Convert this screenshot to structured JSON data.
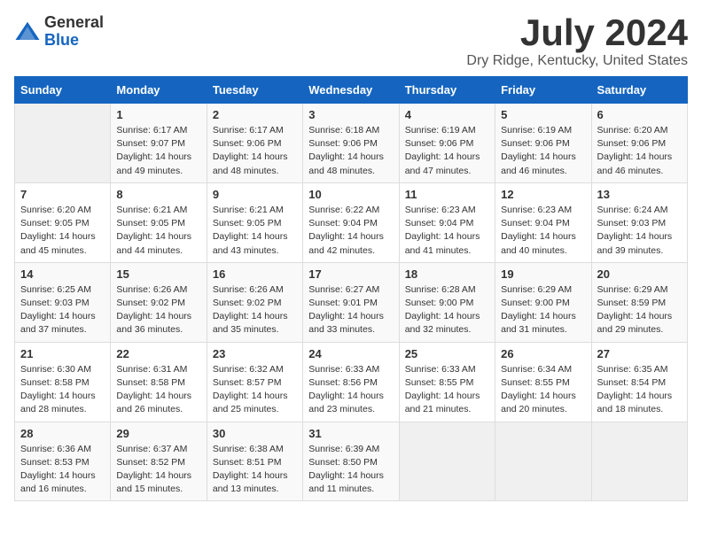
{
  "logo": {
    "general": "General",
    "blue": "Blue"
  },
  "title": "July 2024",
  "subtitle": "Dry Ridge, Kentucky, United States",
  "days_header": [
    "Sunday",
    "Monday",
    "Tuesday",
    "Wednesday",
    "Thursday",
    "Friday",
    "Saturday"
  ],
  "weeks": [
    [
      {
        "day": "",
        "sunrise": "",
        "sunset": "",
        "daylight": ""
      },
      {
        "day": "1",
        "sunrise": "Sunrise: 6:17 AM",
        "sunset": "Sunset: 9:07 PM",
        "daylight": "Daylight: 14 hours and 49 minutes."
      },
      {
        "day": "2",
        "sunrise": "Sunrise: 6:17 AM",
        "sunset": "Sunset: 9:06 PM",
        "daylight": "Daylight: 14 hours and 48 minutes."
      },
      {
        "day": "3",
        "sunrise": "Sunrise: 6:18 AM",
        "sunset": "Sunset: 9:06 PM",
        "daylight": "Daylight: 14 hours and 48 minutes."
      },
      {
        "day": "4",
        "sunrise": "Sunrise: 6:19 AM",
        "sunset": "Sunset: 9:06 PM",
        "daylight": "Daylight: 14 hours and 47 minutes."
      },
      {
        "day": "5",
        "sunrise": "Sunrise: 6:19 AM",
        "sunset": "Sunset: 9:06 PM",
        "daylight": "Daylight: 14 hours and 46 minutes."
      },
      {
        "day": "6",
        "sunrise": "Sunrise: 6:20 AM",
        "sunset": "Sunset: 9:06 PM",
        "daylight": "Daylight: 14 hours and 46 minutes."
      }
    ],
    [
      {
        "day": "7",
        "sunrise": "Sunrise: 6:20 AM",
        "sunset": "Sunset: 9:05 PM",
        "daylight": "Daylight: 14 hours and 45 minutes."
      },
      {
        "day": "8",
        "sunrise": "Sunrise: 6:21 AM",
        "sunset": "Sunset: 9:05 PM",
        "daylight": "Daylight: 14 hours and 44 minutes."
      },
      {
        "day": "9",
        "sunrise": "Sunrise: 6:21 AM",
        "sunset": "Sunset: 9:05 PM",
        "daylight": "Daylight: 14 hours and 43 minutes."
      },
      {
        "day": "10",
        "sunrise": "Sunrise: 6:22 AM",
        "sunset": "Sunset: 9:04 PM",
        "daylight": "Daylight: 14 hours and 42 minutes."
      },
      {
        "day": "11",
        "sunrise": "Sunrise: 6:23 AM",
        "sunset": "Sunset: 9:04 PM",
        "daylight": "Daylight: 14 hours and 41 minutes."
      },
      {
        "day": "12",
        "sunrise": "Sunrise: 6:23 AM",
        "sunset": "Sunset: 9:04 PM",
        "daylight": "Daylight: 14 hours and 40 minutes."
      },
      {
        "day": "13",
        "sunrise": "Sunrise: 6:24 AM",
        "sunset": "Sunset: 9:03 PM",
        "daylight": "Daylight: 14 hours and 39 minutes."
      }
    ],
    [
      {
        "day": "14",
        "sunrise": "Sunrise: 6:25 AM",
        "sunset": "Sunset: 9:03 PM",
        "daylight": "Daylight: 14 hours and 37 minutes."
      },
      {
        "day": "15",
        "sunrise": "Sunrise: 6:26 AM",
        "sunset": "Sunset: 9:02 PM",
        "daylight": "Daylight: 14 hours and 36 minutes."
      },
      {
        "day": "16",
        "sunrise": "Sunrise: 6:26 AM",
        "sunset": "Sunset: 9:02 PM",
        "daylight": "Daylight: 14 hours and 35 minutes."
      },
      {
        "day": "17",
        "sunrise": "Sunrise: 6:27 AM",
        "sunset": "Sunset: 9:01 PM",
        "daylight": "Daylight: 14 hours and 33 minutes."
      },
      {
        "day": "18",
        "sunrise": "Sunrise: 6:28 AM",
        "sunset": "Sunset: 9:00 PM",
        "daylight": "Daylight: 14 hours and 32 minutes."
      },
      {
        "day": "19",
        "sunrise": "Sunrise: 6:29 AM",
        "sunset": "Sunset: 9:00 PM",
        "daylight": "Daylight: 14 hours and 31 minutes."
      },
      {
        "day": "20",
        "sunrise": "Sunrise: 6:29 AM",
        "sunset": "Sunset: 8:59 PM",
        "daylight": "Daylight: 14 hours and 29 minutes."
      }
    ],
    [
      {
        "day": "21",
        "sunrise": "Sunrise: 6:30 AM",
        "sunset": "Sunset: 8:58 PM",
        "daylight": "Daylight: 14 hours and 28 minutes."
      },
      {
        "day": "22",
        "sunrise": "Sunrise: 6:31 AM",
        "sunset": "Sunset: 8:58 PM",
        "daylight": "Daylight: 14 hours and 26 minutes."
      },
      {
        "day": "23",
        "sunrise": "Sunrise: 6:32 AM",
        "sunset": "Sunset: 8:57 PM",
        "daylight": "Daylight: 14 hours and 25 minutes."
      },
      {
        "day": "24",
        "sunrise": "Sunrise: 6:33 AM",
        "sunset": "Sunset: 8:56 PM",
        "daylight": "Daylight: 14 hours and 23 minutes."
      },
      {
        "day": "25",
        "sunrise": "Sunrise: 6:33 AM",
        "sunset": "Sunset: 8:55 PM",
        "daylight": "Daylight: 14 hours and 21 minutes."
      },
      {
        "day": "26",
        "sunrise": "Sunrise: 6:34 AM",
        "sunset": "Sunset: 8:55 PM",
        "daylight": "Daylight: 14 hours and 20 minutes."
      },
      {
        "day": "27",
        "sunrise": "Sunrise: 6:35 AM",
        "sunset": "Sunset: 8:54 PM",
        "daylight": "Daylight: 14 hours and 18 minutes."
      }
    ],
    [
      {
        "day": "28",
        "sunrise": "Sunrise: 6:36 AM",
        "sunset": "Sunset: 8:53 PM",
        "daylight": "Daylight: 14 hours and 16 minutes."
      },
      {
        "day": "29",
        "sunrise": "Sunrise: 6:37 AM",
        "sunset": "Sunset: 8:52 PM",
        "daylight": "Daylight: 14 hours and 15 minutes."
      },
      {
        "day": "30",
        "sunrise": "Sunrise: 6:38 AM",
        "sunset": "Sunset: 8:51 PM",
        "daylight": "Daylight: 14 hours and 13 minutes."
      },
      {
        "day": "31",
        "sunrise": "Sunrise: 6:39 AM",
        "sunset": "Sunset: 8:50 PM",
        "daylight": "Daylight: 14 hours and 11 minutes."
      },
      {
        "day": "",
        "sunrise": "",
        "sunset": "",
        "daylight": ""
      },
      {
        "day": "",
        "sunrise": "",
        "sunset": "",
        "daylight": ""
      },
      {
        "day": "",
        "sunrise": "",
        "sunset": "",
        "daylight": ""
      }
    ]
  ]
}
